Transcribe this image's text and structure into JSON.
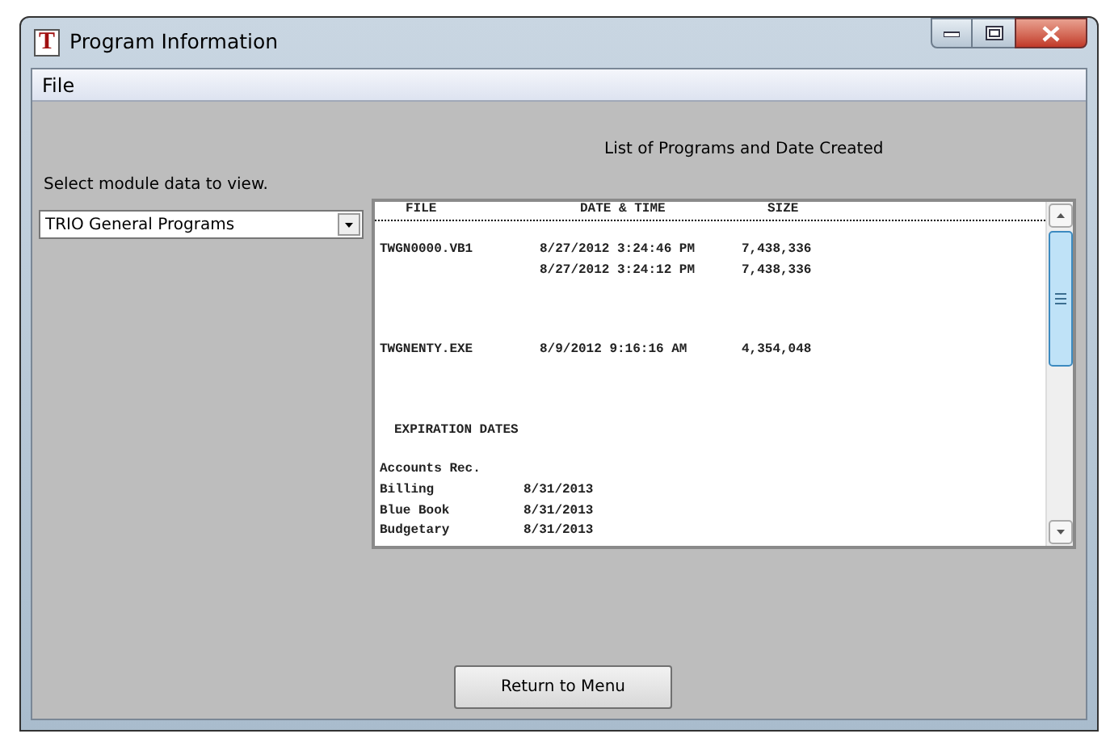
{
  "window": {
    "logo": "T",
    "title": "Program Information"
  },
  "menu": [
    "File"
  ],
  "module_select": {
    "label": "Select module data to view.",
    "value": "TRIO General Programs"
  },
  "listing": {
    "title": "List of Programs and Date Created",
    "columns": [
      "FILE",
      "DATE & TIME",
      "SIZE"
    ],
    "files": [
      {
        "name": "TWGN0000.VB1",
        "entries": [
          {
            "date_time": "8/27/2012 3:24:46 PM",
            "size": "7,438,336"
          },
          {
            "date_time": "8/27/2012 3:24:12 PM",
            "size": "7,438,336"
          }
        ]
      },
      {
        "name": "TWGNENTY.EXE",
        "entries": [
          {
            "date_time": "8/9/2012 9:16:16 AM",
            "size": "4,354,048"
          }
        ]
      }
    ],
    "section_title": "EXPIRATION DATES",
    "group": "Accounts Rec.",
    "expirations": [
      {
        "module": "Billing",
        "date": "8/31/2013"
      },
      {
        "module": "Blue Book",
        "date": "8/31/2013"
      },
      {
        "module": "Budgetary",
        "date": "8/31/2013"
      }
    ]
  },
  "buttons": [
    "Return to Menu"
  ]
}
